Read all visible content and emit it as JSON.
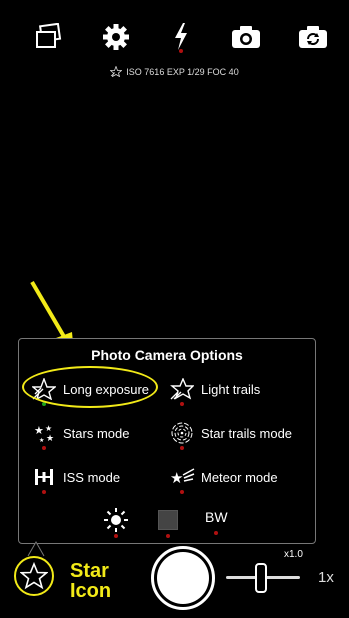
{
  "toolbar": {
    "icons": [
      "gallery-icon",
      "gear-icon",
      "flash-icon",
      "camera-icon",
      "switch-camera-icon"
    ]
  },
  "info": {
    "text": "ISO 7616 EXP 1/29 FOC 40"
  },
  "options_panel": {
    "title": "Photo Camera Options",
    "items": [
      {
        "label": "Long exposure",
        "icon": "long-exposure-icon"
      },
      {
        "label": "Light trails",
        "icon": "light-trails-icon"
      },
      {
        "label": "Stars mode",
        "icon": "stars-icon"
      },
      {
        "label": "Star trails mode",
        "icon": "star-trails-icon"
      },
      {
        "label": "ISS mode",
        "icon": "iss-icon"
      },
      {
        "label": "Meteor mode",
        "icon": "meteor-icon"
      }
    ],
    "bottom": {
      "bw_label": "BW"
    }
  },
  "bottom_bar": {
    "star_caption_line1": "Star",
    "star_caption_line2": "Icon",
    "zoom_readout": "x1.0",
    "zoom_label": "1x"
  },
  "colors": {
    "accent": "#f2ea18",
    "indicator_red": "#b01010",
    "indicator_green": "#1ca21c"
  }
}
